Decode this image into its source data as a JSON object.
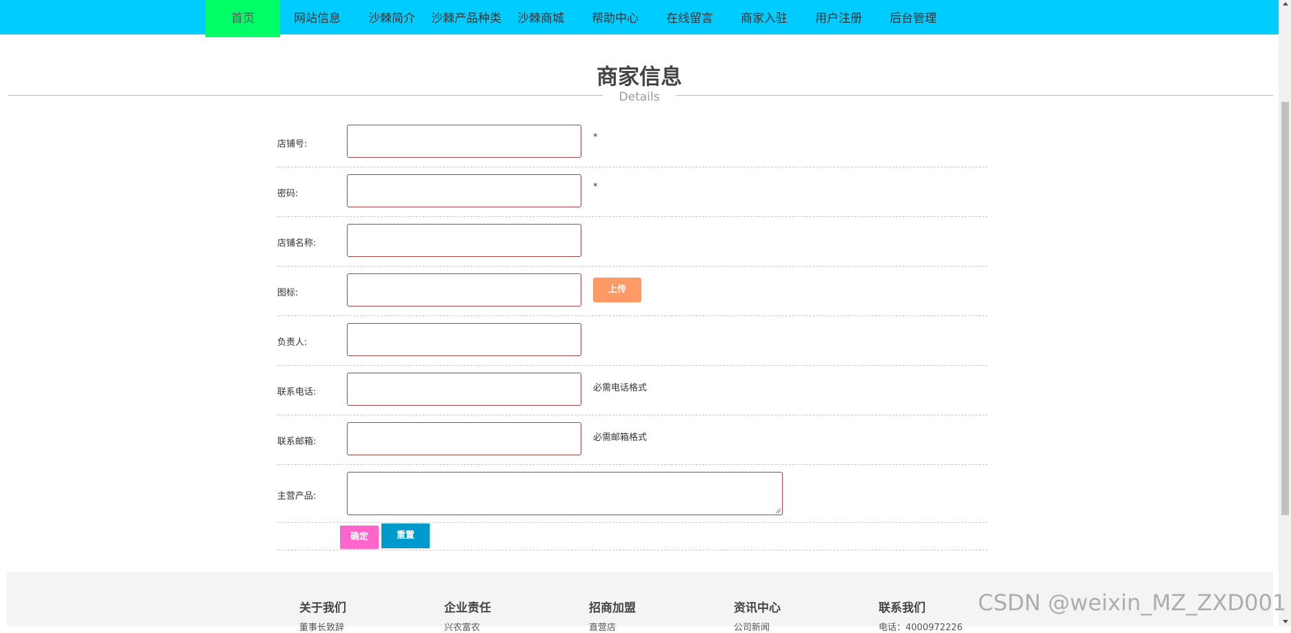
{
  "nav": {
    "items": [
      {
        "label": "首页",
        "active": true
      },
      {
        "label": "网站信息"
      },
      {
        "label": "沙棘简介"
      },
      {
        "label": "沙棘产品种类"
      },
      {
        "label": "沙棘商城"
      },
      {
        "label": "帮助中心"
      },
      {
        "label": "在线留言"
      },
      {
        "label": "商家入驻"
      },
      {
        "label": "用户注册"
      },
      {
        "label": "后台管理"
      }
    ]
  },
  "page": {
    "title": "商家信息",
    "subtitle": "Details"
  },
  "form": {
    "fields": [
      {
        "label": "店铺号:",
        "value": "",
        "hint": "*"
      },
      {
        "label": "密码:",
        "value": "",
        "hint": "*"
      },
      {
        "label": "店铺名称:",
        "value": ""
      },
      {
        "label": "图标:",
        "value": ""
      },
      {
        "label": "负责人:",
        "value": ""
      },
      {
        "label": "联系电话:",
        "value": "",
        "hint": "必需电话格式"
      },
      {
        "label": "联系邮箱:",
        "value": "",
        "hint": "必需邮箱格式"
      },
      {
        "label": "主营产品:",
        "value": ""
      }
    ],
    "upload_label": "上传",
    "confirm_label": "确定",
    "reset_label": "重置"
  },
  "footer": {
    "columns": [
      {
        "title": "关于我们",
        "first_item": "董事长致辞"
      },
      {
        "title": "企业责任",
        "first_item": "兴农富农"
      },
      {
        "title": "招商加盟",
        "first_item": "直营店"
      },
      {
        "title": "资讯中心",
        "first_item": "公司新闻"
      },
      {
        "title": "联系我们",
        "first_item": "电话：4000972226"
      }
    ]
  },
  "watermark": "CSDN @weixin_MZ_ZXD001",
  "colors": {
    "nav_bg": "#00ccff",
    "nav_active": "#00ff66",
    "input_border": "#a3444c",
    "upload": "#ff9966",
    "confirm": "#ff66cc",
    "reset": "#0099cc"
  }
}
